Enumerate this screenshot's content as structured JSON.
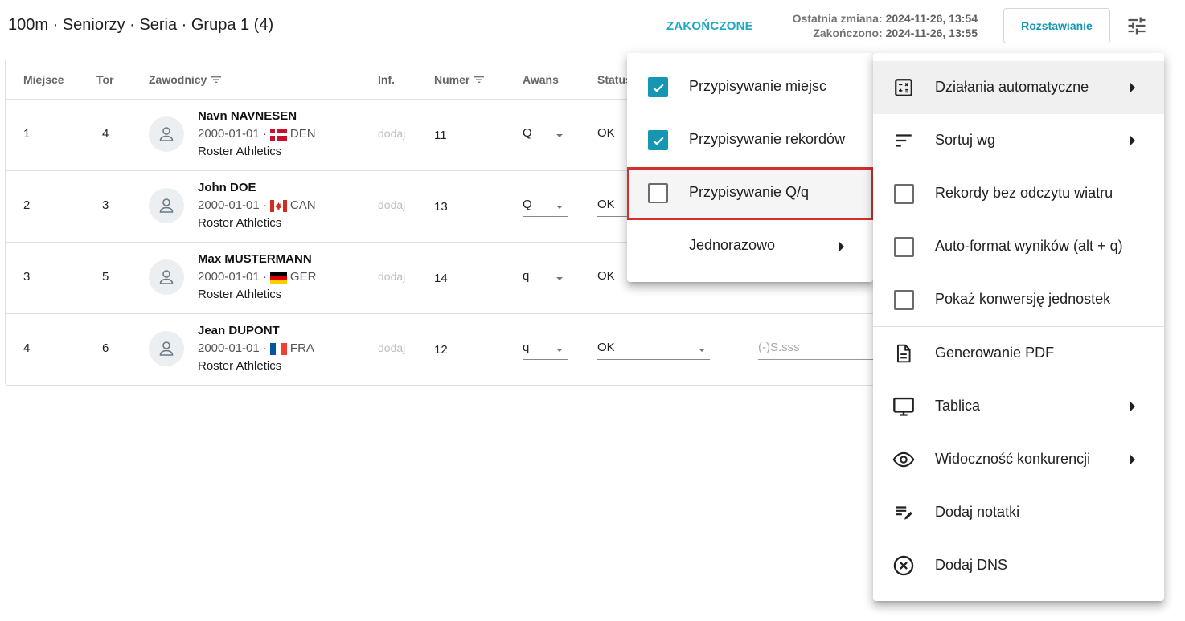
{
  "header": {
    "title": "100m · Seniorzy · Seria · Grupa 1 (4)",
    "status": "ZAKOŃCZONE",
    "last_change_label": "Ostatnia zmiana:",
    "last_change_value": "2024-11-26, 13:54",
    "finished_label": "Zakończono:",
    "finished_value": "2024-11-26, 13:55",
    "seeding_button": "Rozstawianie",
    "settings_icon": "tune-icon"
  },
  "table": {
    "columns": [
      "Miejsce",
      "Tor",
      "Zawodnicy",
      "Inf.",
      "Numer",
      "Awans",
      "Status"
    ],
    "rows": [
      {
        "place": "1",
        "lane": "4",
        "name": "Navn NAVNESEN",
        "birth": "2000-01-01 ·",
        "country": "DEN",
        "club": "Roster Athletics",
        "inf": "dodaj",
        "number": "11",
        "advance": "Q",
        "status": "OK",
        "result": ""
      },
      {
        "place": "2",
        "lane": "3",
        "name": "John DOE",
        "birth": "2000-01-01 ·",
        "country": "CAN",
        "club": "Roster Athletics",
        "inf": "dodaj",
        "number": "13",
        "advance": "Q",
        "status": "OK",
        "result": ""
      },
      {
        "place": "3",
        "lane": "5",
        "name": "Max MUSTERMANN",
        "birth": "2000-01-01 ·",
        "country": "GER",
        "club": "Roster Athletics",
        "inf": "dodaj",
        "number": "14",
        "advance": "q",
        "status": "OK",
        "result": ""
      },
      {
        "place": "4",
        "lane": "6",
        "name": "Jean DUPONT",
        "birth": "2000-01-01 ·",
        "country": "FRA",
        "club": "Roster Athletics",
        "inf": "dodaj",
        "number": "12",
        "advance": "q",
        "status": "OK",
        "result": "(-)S.sss"
      }
    ]
  },
  "submenu": {
    "items": [
      {
        "label": "Przypisywanie miejsc",
        "checked": true
      },
      {
        "label": "Przypisywanie rekordów",
        "checked": true
      },
      {
        "label": "Przypisywanie Q/q",
        "checked": false
      },
      {
        "label": "Jednorazowo",
        "has_submenu": true
      }
    ]
  },
  "menu": {
    "items": [
      {
        "label": "Działania automatyczne",
        "icon": "calculator-icon",
        "has_submenu": true
      },
      {
        "label": "Sortuj wg",
        "icon": "sort-icon",
        "has_submenu": true
      },
      {
        "label": "Rekordy bez odczytu wiatru",
        "icon": "checkbox",
        "checked": false
      },
      {
        "label": "Auto-format wyników (alt + q)",
        "icon": "checkbox",
        "checked": false
      },
      {
        "label": "Pokaż konwersję jednostek",
        "icon": "checkbox",
        "checked": false
      },
      {
        "label": "Generowanie PDF",
        "icon": "document-icon"
      },
      {
        "label": "Tablica",
        "icon": "monitor-icon",
        "has_submenu": true
      },
      {
        "label": "Widoczność konkurencji",
        "icon": "eye-icon",
        "has_submenu": true
      },
      {
        "label": "Dodaj notatki",
        "icon": "notes-edit-icon"
      },
      {
        "label": "Dodaj DNS",
        "icon": "cancel-circle-icon"
      }
    ]
  },
  "colors": {
    "accent": "#1597b3",
    "status": "#1ea7c5",
    "highlight": "#d32f2f"
  }
}
